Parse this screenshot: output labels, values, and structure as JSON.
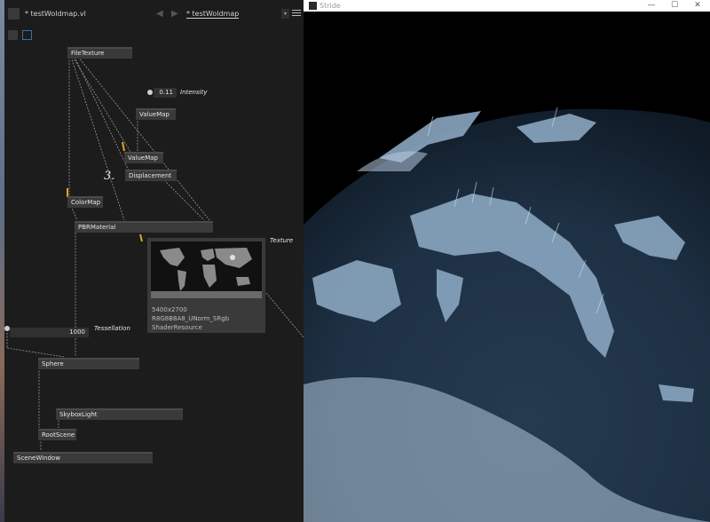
{
  "editor": {
    "tab_file": "* testWoldmap.vl",
    "tab_patch": "* testWoldmap",
    "nav_back": "◀",
    "nav_forward": "▶",
    "dropdown": "▾"
  },
  "nodes": {
    "file_texture": "FileTexture",
    "value_map_1": "ValueMap",
    "value_map_2": "ValueMap",
    "displacement": "Displacement",
    "color_map": "ColorMap",
    "pbr_material": "PBRMaterial",
    "sphere": "Sphere",
    "skybox_light": "SkyboxLight",
    "root_scene": "RootScene",
    "scene_window": "SceneWindow"
  },
  "pads": {
    "intensity_value": "0.11",
    "intensity_label": "Intensity",
    "tessellation_value": "1000",
    "tessellation_label": "Tessellation",
    "texture_label": "Texture"
  },
  "annotation": "3.",
  "texture_tooltip": {
    "size": "5400x2700",
    "format": "R8G8B8A8_UNorm_SRgb",
    "kind": "ShaderResource"
  },
  "render_window": {
    "title": "Stride",
    "minimize": "—",
    "maximize": "☐",
    "close": "✕"
  },
  "colors": {
    "editor_bg": "#1c1c1c",
    "node_bg": "#3a3a3a",
    "link_orange": "#e8a020",
    "globe_base": "#1b2a3a",
    "globe_land": "#a8c0d6"
  }
}
